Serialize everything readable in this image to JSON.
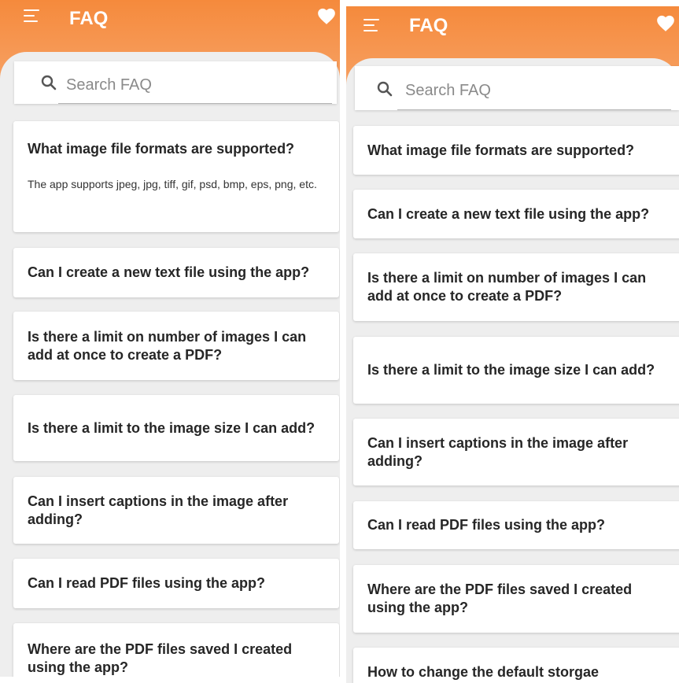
{
  "colors": {
    "accent": "#f58a3c",
    "background": "#eeeeee",
    "card": "#ffffff"
  },
  "icons": {
    "menu": "menu-icon",
    "favorite": "heart-icon",
    "search": "search-icon"
  },
  "left": {
    "title": "FAQ",
    "search_placeholder": "Search FAQ",
    "faqs": [
      {
        "question": "What image file formats are supported?",
        "answer": "The app supports jpeg, jpg, tiff, gif, psd, bmp, eps, png, etc."
      },
      {
        "question": "Can I create a new text file using the app?"
      },
      {
        "question": "Is there a limit on number of images I can add at once to create a PDF?"
      },
      {
        "question": "Is there a limit to the image size I can add?"
      },
      {
        "question": "Can I insert captions in the image after adding?"
      },
      {
        "question": "Can I read PDF files using the app?"
      },
      {
        "question": "Where are the PDF files saved I created using the app?"
      }
    ]
  },
  "right": {
    "title": "FAQ",
    "search_placeholder": "Search FAQ",
    "faqs": [
      {
        "question": "What image file formats are supported?"
      },
      {
        "question": "Can I create a new text file using the app?"
      },
      {
        "question": "Is there a limit on number of images I can add at once to create a PDF?"
      },
      {
        "question": "Is there a limit to the image size I can add?"
      },
      {
        "question": "Can I insert captions in the image after adding?"
      },
      {
        "question": "Can I read PDF files using the app?"
      },
      {
        "question": "Where are the PDF files saved I created using the app?"
      },
      {
        "question": "How to change the default storgae"
      }
    ]
  }
}
